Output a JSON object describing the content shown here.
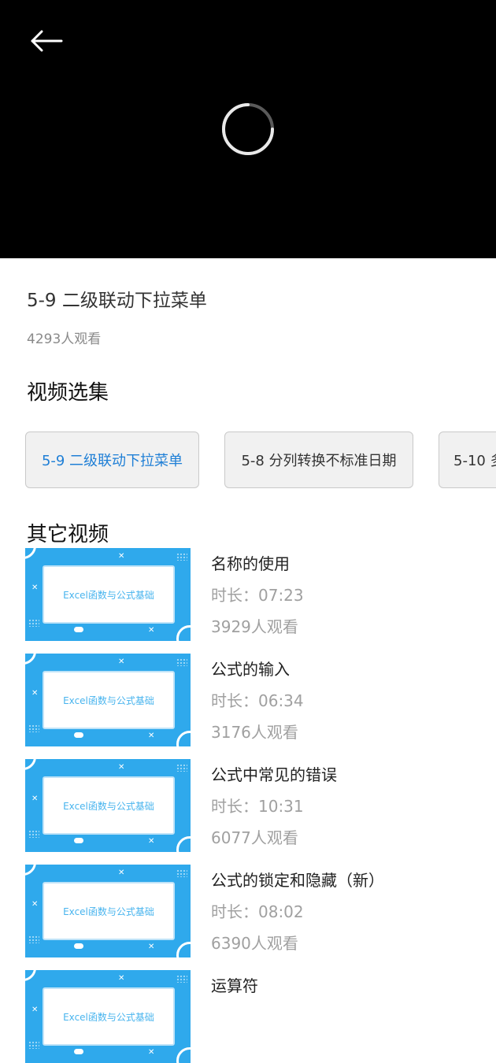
{
  "video": {
    "title": "5-9 二级联动下拉菜单",
    "views": "4293人观看"
  },
  "episodes": {
    "section_title": "视频选集",
    "items": [
      {
        "label": "5-9 二级联动下拉菜单",
        "active": true
      },
      {
        "label": "5-8 分列转换不标准日期",
        "active": false
      },
      {
        "label": "5-10 多",
        "active": false
      }
    ]
  },
  "others": {
    "section_title": "其它视频",
    "thumbnail_text": "Excel函数与公式基础",
    "items": [
      {
        "name": "名称的使用",
        "duration": "时长：07:23",
        "views": "3929人观看"
      },
      {
        "name": "公式的输入",
        "duration": "时长：06:34",
        "views": "3176人观看"
      },
      {
        "name": "公式中常见的错误",
        "duration": "时长：10:31",
        "views": "6077人观看"
      },
      {
        "name": "公式的锁定和隐藏（新）",
        "duration": "时长：08:02",
        "views": "6390人观看"
      },
      {
        "name": "运算符",
        "duration": "",
        "views": ""
      }
    ]
  },
  "colors": {
    "accent": "#1f7fd6",
    "thumbnail_bg": "#2fa9ec"
  },
  "icons": {
    "back": "back-arrow-icon",
    "loading": "loading-spinner-icon"
  }
}
